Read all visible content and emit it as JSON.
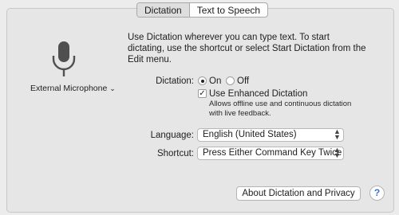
{
  "tabs": [
    {
      "label": "Dictation",
      "selected": true
    },
    {
      "label": "Text to Speech",
      "selected": false
    }
  ],
  "description": "Use Dictation wherever you can type text. To start dictating, use the shortcut or select Start Dictation from the Edit menu.",
  "microphone": {
    "icon": "microphone-icon",
    "source_label": "External Microphone",
    "chevron": "chevron-down-icon"
  },
  "dictation": {
    "label": "Dictation:",
    "on_label": "On",
    "off_label": "Off",
    "value": "On"
  },
  "enhanced": {
    "label": "Use Enhanced Dictation",
    "checked": true,
    "note_line1": "Allows offline use and continuous dictation",
    "note_line2": "with live feedback."
  },
  "language": {
    "label": "Language:",
    "value": "English (United States)"
  },
  "shortcut": {
    "label": "Shortcut:",
    "value": "Press Either Command Key Twice"
  },
  "about_button": "About Dictation and Privacy",
  "help_button": "?"
}
